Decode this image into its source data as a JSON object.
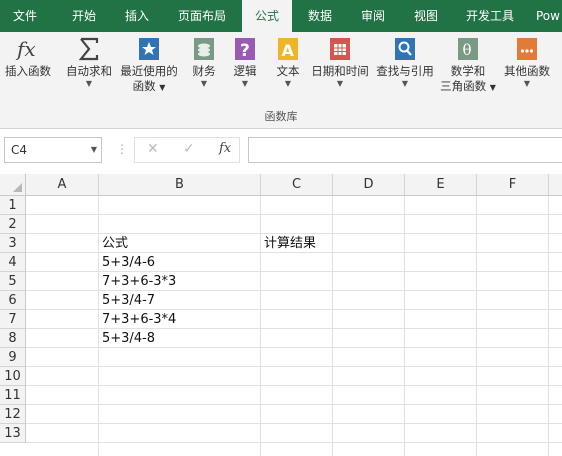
{
  "tabs": [
    {
      "label": "文件",
      "active": false
    },
    {
      "label": "开始",
      "active": false
    },
    {
      "label": "插入",
      "active": false
    },
    {
      "label": "页面布局",
      "active": false
    },
    {
      "label": "公式",
      "active": true
    },
    {
      "label": "数据",
      "active": false
    },
    {
      "label": "审阅",
      "active": false
    },
    {
      "label": "视图",
      "active": false
    },
    {
      "label": "开发工具",
      "active": false
    },
    {
      "label": "Pow",
      "active": false
    }
  ],
  "ribbon": {
    "buttons": [
      {
        "line1": "插入函数",
        "line2": "",
        "dropdown": false,
        "icon": "fx-icon"
      },
      {
        "line1": "自动求和",
        "line2": "",
        "dropdown": true,
        "icon": "sigma-icon"
      },
      {
        "line1": "最近使用的",
        "line2": "函数",
        "dropdown": true,
        "icon": "star-book-icon"
      },
      {
        "line1": "财务",
        "line2": "",
        "dropdown": true,
        "icon": "finance-book-icon"
      },
      {
        "line1": "逻辑",
        "line2": "",
        "dropdown": true,
        "icon": "question-book-icon"
      },
      {
        "line1": "文本",
        "line2": "",
        "dropdown": true,
        "icon": "text-book-icon"
      },
      {
        "line1": "日期和时间",
        "line2": "",
        "dropdown": true,
        "icon": "calendar-book-icon"
      },
      {
        "line1": "查找与引用",
        "line2": "",
        "dropdown": true,
        "icon": "search-book-icon"
      },
      {
        "line1": "数学和",
        "line2": "三角函数",
        "dropdown": true,
        "icon": "theta-book-icon"
      },
      {
        "line1": "其他函数",
        "line2": "",
        "dropdown": true,
        "icon": "more-book-icon"
      }
    ],
    "group_label": "函数库"
  },
  "formula_bar": {
    "name_box": "C4",
    "cancel_symbol": "✕",
    "enter_symbol": "✓",
    "fx_symbol": "fx",
    "separator": "⋮",
    "value": ""
  },
  "columns": [
    "A",
    "B",
    "C",
    "D",
    "E",
    "F"
  ],
  "rows": [
    "1",
    "2",
    "3",
    "4",
    "5",
    "6",
    "7",
    "8",
    "9",
    "10",
    "11",
    "12",
    "13"
  ],
  "cells": {
    "B3": "公式",
    "C3": "计算结果",
    "B4": "5+3/4-6",
    "B5": "7+3+6-3*3",
    "B6": "5+3/4-7",
    "B7": "7+3+6-3*4",
    "B8": "5+3/4-8"
  },
  "colors": {
    "brand_green": "#217346",
    "ribbon_bg": "#f3f3f3"
  }
}
